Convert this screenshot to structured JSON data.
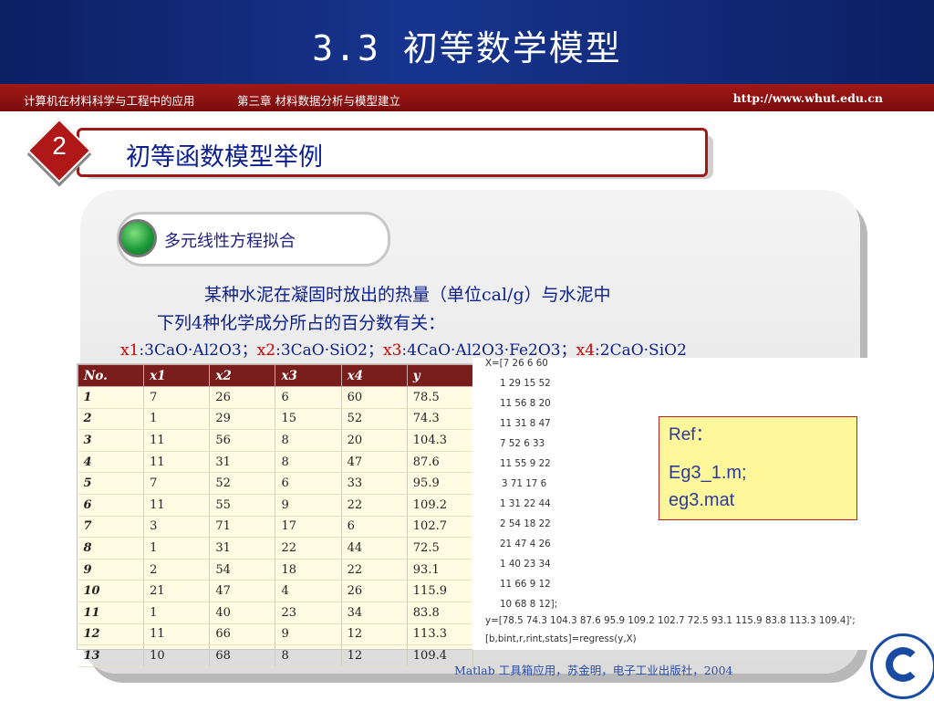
{
  "header": {
    "title": "3.3 初等数学模型",
    "course": "计算机在材料科学与工程中的应用",
    "chapter": "第三章 材料数据分析与模型建立",
    "url": "http://www.whut.edu.cn"
  },
  "section": {
    "number": "2",
    "title": "初等函数模型举例"
  },
  "topic": {
    "label": "多元线性方程拟合"
  },
  "paragraph": {
    "line1": "某种水泥在凝固时放出的热量（单位cal/g）与水泥中",
    "line2": "下列4种化学成分所占的百分数有关："
  },
  "components": [
    {
      "name": "x1",
      "formula": ":3CaO·Al2O3；"
    },
    {
      "name": "x2",
      "formula": ":3CaO·SiO2；"
    },
    {
      "name": "x3",
      "formula": ":4CaO·Al2O3·Fe2O3；"
    },
    {
      "name": "x4",
      "formula": ":2CaO·SiO2"
    }
  ],
  "table": {
    "headers": [
      "No.",
      "x1",
      "x2",
      "x3",
      "x4",
      "y"
    ],
    "rows": [
      [
        "1",
        "7",
        "26",
        "6",
        "60",
        "78.5"
      ],
      [
        "2",
        "1",
        "29",
        "15",
        "52",
        "74.3"
      ],
      [
        "3",
        "11",
        "56",
        "8",
        "20",
        "104.3"
      ],
      [
        "4",
        "11",
        "31",
        "8",
        "47",
        "87.6"
      ],
      [
        "5",
        "7",
        "52",
        "6",
        "33",
        "95.9"
      ],
      [
        "6",
        "11",
        "55",
        "9",
        "22",
        "109.2"
      ],
      [
        "7",
        "3",
        "71",
        "17",
        "6",
        "102.7"
      ],
      [
        "8",
        "1",
        "31",
        "22",
        "44",
        "72.5"
      ],
      [
        "9",
        "2",
        "54",
        "18",
        "22",
        "93.1"
      ],
      [
        "10",
        "21",
        "47",
        "4",
        "26",
        "115.9"
      ],
      [
        "11",
        "1",
        "40",
        "23",
        "34",
        "83.8"
      ],
      [
        "12",
        "11",
        "66",
        "9",
        "12",
        "113.3"
      ],
      [
        "13",
        "10",
        "68",
        "8",
        "12",
        "109.4"
      ]
    ]
  },
  "code": {
    "lines": [
      "X=[7  26  6  60",
      "1  29 15  52",
      "11  56  8  20",
      "11  31  8  47",
      "7  52  6  33",
      "11  55  9  22",
      "3  71  17  6",
      "1  31  22  44",
      "2  54  18  22",
      "21 47    4  26",
      "1 40  23  34",
      "11 66  9    12",
      "10 68  8    12];",
      "y=[78.5 74.3 104.3 87.6 95.9 109.2 102.7 72.5 93.1 115.9 83.8 113.3 109.4]';",
      "[b,bint,r,rint,stats]=regress(y,X)"
    ]
  },
  "ref": {
    "label": "Ref：",
    "line1": "Eg3_1.m;",
    "line2": "eg3.mat"
  },
  "citation": "Matlab 工具箱应用，苏金明，电子工业出版社，2004"
}
